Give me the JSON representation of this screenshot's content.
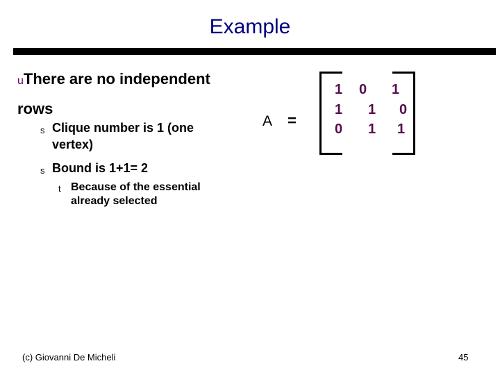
{
  "slide": {
    "title": "Example",
    "bullets": {
      "level1_marker": "u",
      "level1_text_line1": "There are no independent",
      "level1_text_line2": "rows",
      "level2_marker": "s",
      "item1_line1": "Clique number is 1 (one",
      "item1_line2": "vertex)",
      "item2": "Bound is 1+1= 2",
      "level3_marker": "t",
      "item3_line1": "Because of the essential",
      "item3_line2": "already selected"
    },
    "matrix": {
      "label": "A",
      "equals": "=",
      "rows": [
        [
          "1",
          "0",
          "1"
        ],
        [
          "1",
          "1",
          "0"
        ],
        [
          "0",
          "1",
          "1"
        ]
      ]
    },
    "footer": "(c)  Giovanni De Micheli",
    "page_number": "45",
    "colors": {
      "title": "#000080",
      "matrix_values": "#5a0a4f",
      "bullet": "#660066"
    }
  }
}
